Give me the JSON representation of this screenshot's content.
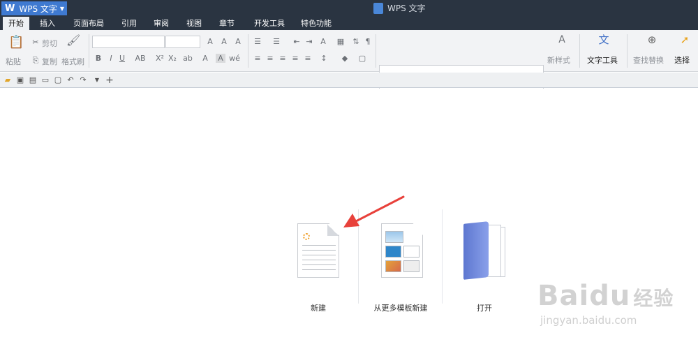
{
  "app": {
    "menu_label": "WPS 文字",
    "window_title": "WPS 文字"
  },
  "tabs": [
    "开始",
    "插入",
    "页面布局",
    "引用",
    "审阅",
    "视图",
    "章节",
    "开发工具",
    "特色功能"
  ],
  "active_tab": 0,
  "ribbon": {
    "paste": "粘贴",
    "cut": "剪切",
    "copy": "复制",
    "format_painter": "格式刷",
    "new_style": "新样式",
    "text_tools": "文字工具",
    "find_replace": "查找替换",
    "select": "选择",
    "bold": "B",
    "italic": "I",
    "underline": "U",
    "superscript": "X²",
    "subscript": "X₂"
  },
  "start_page": {
    "new": "新建",
    "from_template": "从更多模板新建",
    "open": "打开"
  },
  "watermark": {
    "brand": "Baidu",
    "brand_cn": "经验",
    "url": "jingyan.baidu.com"
  },
  "colors": {
    "titlebar": "#2a3441",
    "app_button": "#3f7ad1",
    "arrow": "#e8413b",
    "folder": "#6b86d9"
  }
}
